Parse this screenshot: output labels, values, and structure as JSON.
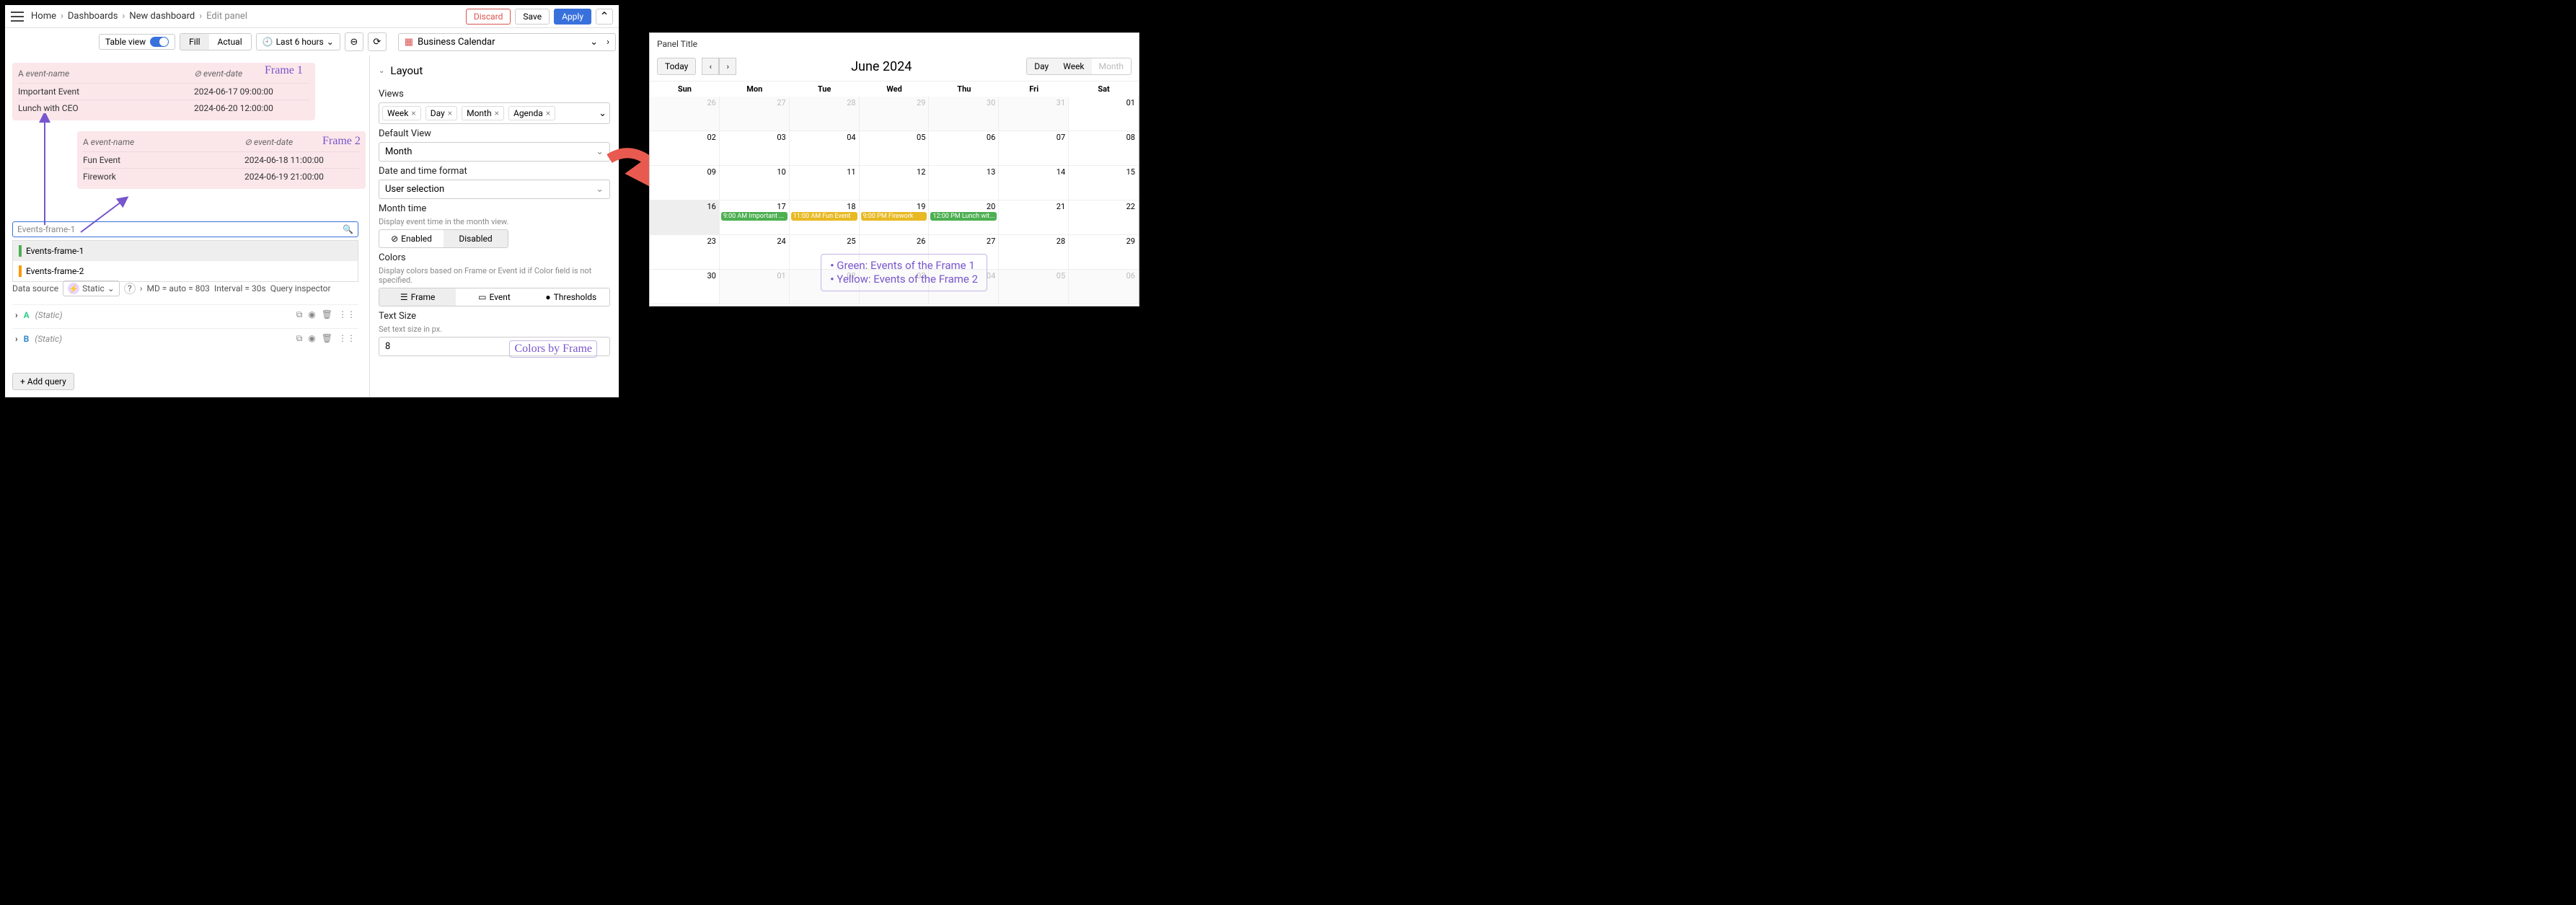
{
  "breadcrumb": {
    "home": "Home",
    "dashboards": "Dashboards",
    "new_dash": "New dashboard",
    "edit": "Edit panel"
  },
  "top_actions": {
    "discard": "Discard",
    "save": "Save",
    "apply": "Apply"
  },
  "toolbar": {
    "table_view": "Table view",
    "fill": "Fill",
    "actual": "Actual",
    "time_range": "Last 6 hours",
    "viz_name": "Business Calendar"
  },
  "frame1": {
    "label": "Frame 1",
    "col_name": "event-name",
    "col_date": "event-date",
    "rows": [
      {
        "name": "Important Event",
        "date": "2024-06-17 09:00:00"
      },
      {
        "name": "Lunch with CEO",
        "date": "2024-06-20 12:00:00"
      }
    ]
  },
  "frame2": {
    "label": "Frame 2",
    "col_name": "event-name",
    "col_date": "event-date",
    "rows": [
      {
        "name": "Fun Event",
        "date": "2024-06-18 11:00:00"
      },
      {
        "name": "Firework",
        "date": "2024-06-19 21:00:00"
      }
    ]
  },
  "search_placeholder": "Events-frame-1",
  "dropdown": {
    "a": "Events-frame-1",
    "b": "Events-frame-2"
  },
  "ds": {
    "label": "Data source",
    "name": "Static",
    "md": "MD = auto = 803",
    "interval": "Interval = 30s",
    "inspect": "Query inspector"
  },
  "queries": {
    "a": "A",
    "b": "B",
    "static": "(Static)"
  },
  "add_query": "Add query",
  "layout": {
    "header": "Layout",
    "views_label": "Views",
    "view_chips": {
      "week": "Week",
      "day": "Day",
      "month": "Month",
      "agenda": "Agenda"
    },
    "default_view_label": "Default View",
    "default_view": "Month",
    "dtf_label": "Date and time format",
    "dtf_value": "User selection",
    "month_time_label": "Month time",
    "month_time_desc": "Display event time in the month view.",
    "enabled": "Enabled",
    "disabled": "Disabled",
    "colors_label": "Colors",
    "colors_desc": "Display colors based on Frame or Event id if Color field is not specified.",
    "color_frame": "Frame",
    "color_event": "Event",
    "color_thresh": "Thresholds",
    "text_size_label": "Text Size",
    "text_size_desc": "Set text size in px.",
    "text_size_value": "8",
    "colors_by_frame": "Colors by Frame"
  },
  "calendar": {
    "panel_title": "Panel Title",
    "today": "Today",
    "month_year": "June 2024",
    "views": {
      "day": "Day",
      "week": "Week",
      "month": "Month"
    },
    "dow": {
      "sun": "Sun",
      "mon": "Mon",
      "tue": "Tue",
      "wed": "Wed",
      "thu": "Thu",
      "fri": "Fri",
      "sat": "Sat"
    },
    "events": {
      "e1": "9:00 AM Important ...",
      "e2": "11:00 AM Fun Event",
      "e3": "9:00 PM Firework",
      "e4": "12:00 PM Lunch wit..."
    },
    "legend": {
      "l1": "Green: Events of the Frame 1",
      "l2": "Yellow: Events of the Frame 2"
    }
  }
}
